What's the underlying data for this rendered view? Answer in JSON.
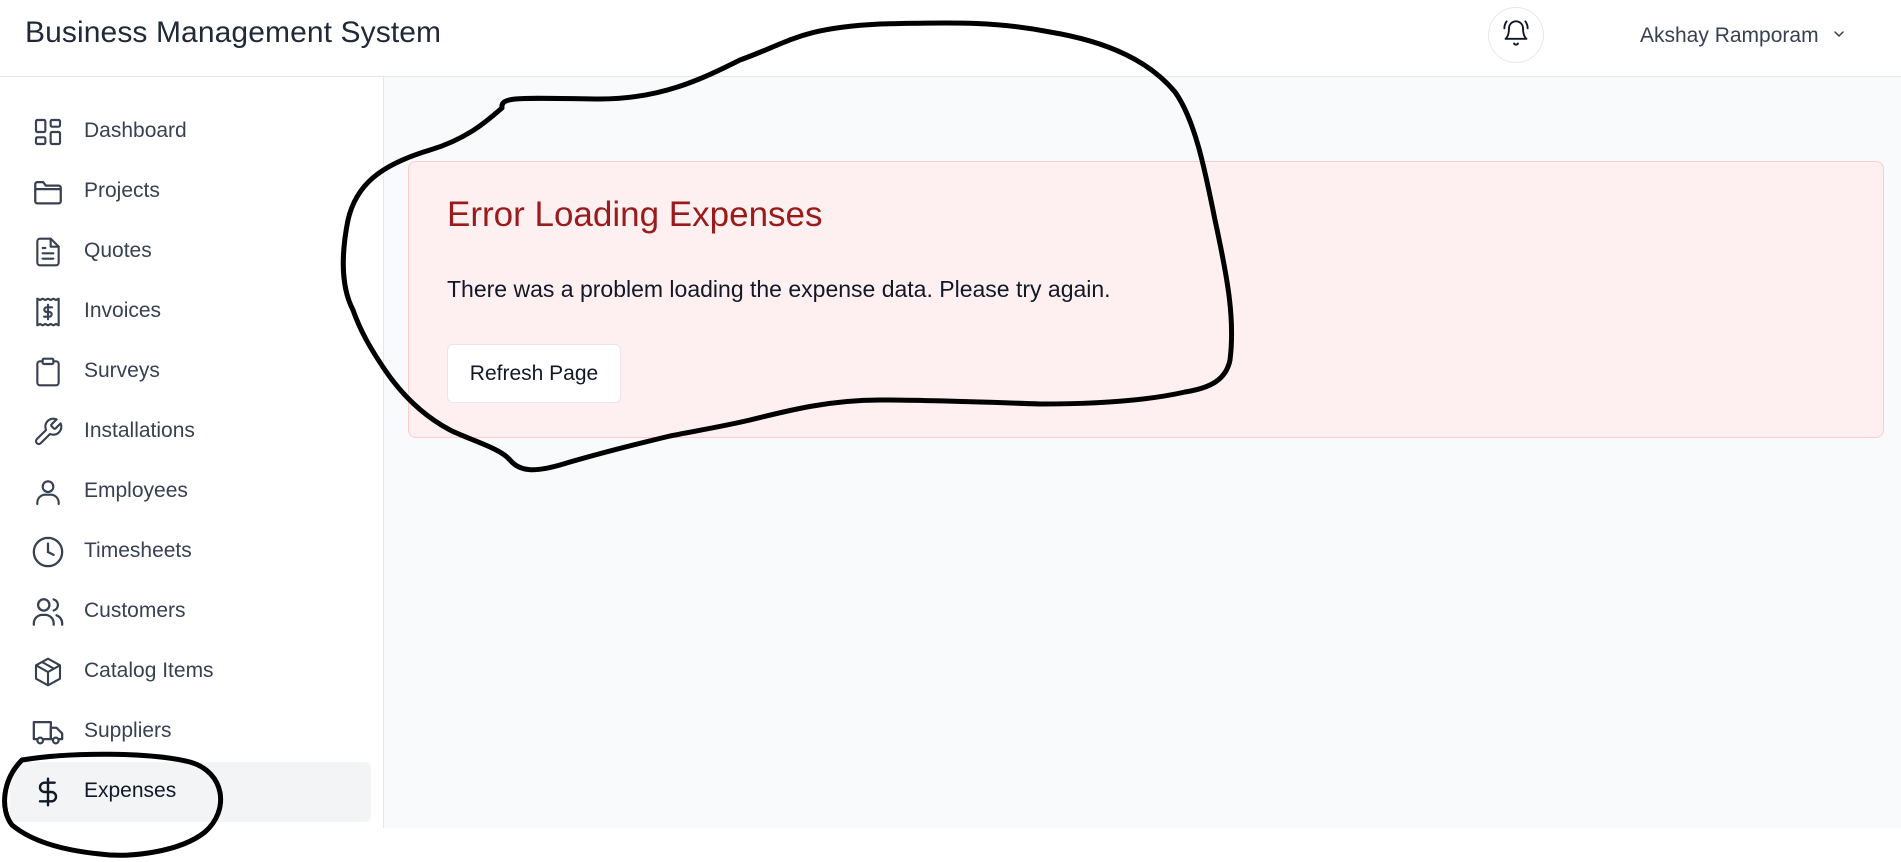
{
  "header": {
    "title": "Business Management System",
    "user_name": "Akshay Ramporam"
  },
  "sidebar": {
    "items": [
      {
        "label": "Dashboard",
        "icon": "dashboard-grid-icon"
      },
      {
        "label": "Projects",
        "icon": "folder-icon"
      },
      {
        "label": "Quotes",
        "icon": "document-icon"
      },
      {
        "label": "Invoices",
        "icon": "receipt-dollar-icon"
      },
      {
        "label": "Surveys",
        "icon": "clipboard-icon"
      },
      {
        "label": "Installations",
        "icon": "wrench-icon"
      },
      {
        "label": "Employees",
        "icon": "user-icon"
      },
      {
        "label": "Timesheets",
        "icon": "clock-icon"
      },
      {
        "label": "Customers",
        "icon": "users-icon"
      },
      {
        "label": "Catalog Items",
        "icon": "package-icon"
      },
      {
        "label": "Suppliers",
        "icon": "truck-icon"
      },
      {
        "label": "Expenses",
        "icon": "dollar-icon",
        "active": true
      }
    ]
  },
  "error": {
    "title": "Error Loading Expenses",
    "message": "There was a problem loading the expense data. Please try again.",
    "button_label": "Refresh Page"
  },
  "colors": {
    "error_title": "#991b1b",
    "error_background": "#fef0f0",
    "error_border": "#fecaca",
    "active_nav": "#f3f4f6",
    "annotation_ink": "#000000"
  }
}
